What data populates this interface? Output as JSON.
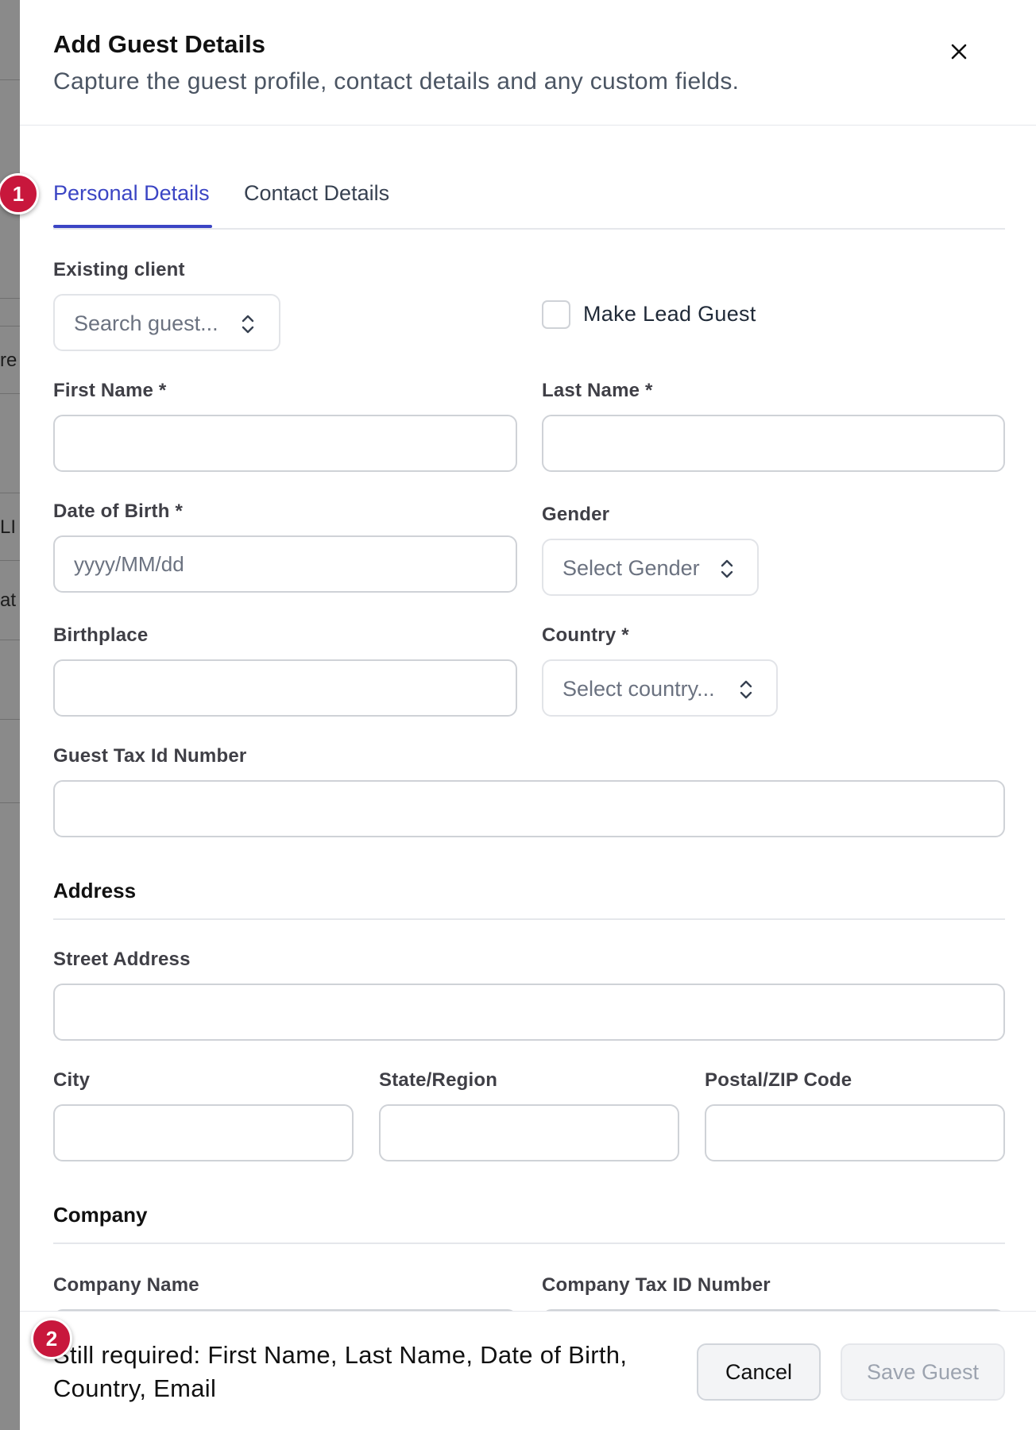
{
  "background": {
    "fragments": [
      "re",
      "LI",
      "at"
    ]
  },
  "drawer": {
    "title": "Add Guest Details",
    "subtitle": "Capture the guest profile, contact details and any custom fields.",
    "close_icon": "close-icon"
  },
  "tabs": [
    {
      "label": "Personal Details",
      "active": true
    },
    {
      "label": "Contact Details",
      "active": false
    }
  ],
  "form": {
    "existing_client": {
      "label": "Existing client",
      "placeholder": "Search guest..."
    },
    "make_lead_guest": {
      "label": "Make Lead Guest",
      "checked": false
    },
    "first_name": {
      "label": "First Name *",
      "value": ""
    },
    "last_name": {
      "label": "Last Name *",
      "value": ""
    },
    "date_of_birth": {
      "label": "Date of Birth *",
      "placeholder": "yyyy/MM/dd"
    },
    "gender": {
      "label": "Gender",
      "placeholder": "Select Gender"
    },
    "birthplace": {
      "label": "Birthplace",
      "value": ""
    },
    "country": {
      "label": "Country *",
      "placeholder": "Select country..."
    },
    "guest_tax_id": {
      "label": "Guest Tax Id Number",
      "value": ""
    }
  },
  "address": {
    "title": "Address",
    "street": {
      "label": "Street Address"
    },
    "city": {
      "label": "City"
    },
    "state": {
      "label": "State/Region"
    },
    "postal": {
      "label": "Postal/ZIP Code"
    }
  },
  "company": {
    "title": "Company",
    "name": {
      "label": "Company Name"
    },
    "tax_id": {
      "label": "Company Tax ID Number"
    }
  },
  "footer": {
    "message": "Still required: First Name, Last Name, Date of Birth, Country, Email",
    "cancel_label": "Cancel",
    "save_label": "Save Guest"
  },
  "markers": [
    "1",
    "2"
  ],
  "colors": {
    "accent": "#3b45c4",
    "marker": "#c8173c"
  }
}
